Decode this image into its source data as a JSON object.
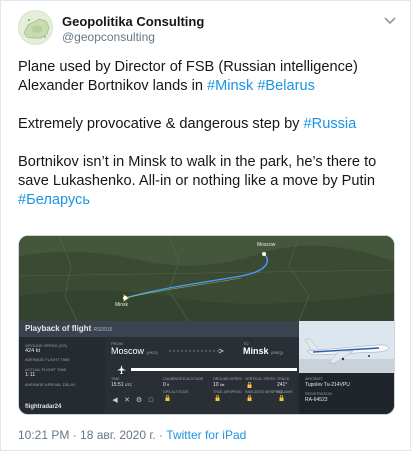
{
  "author": {
    "name": "Geopolitika Consulting",
    "handle": "@geopconsulting"
  },
  "tweet": {
    "line1": "Plane used by Director of FSB (Russian intelligence) Alexander Bortnikov lands in ",
    "tag_minsk": "#Minsk",
    "tag_belarus": "#Belarus",
    "line2": "Extremely provocative & dangerous step by ",
    "tag_russia": "#Russia",
    "line3": "Bortnikov isn’t in Minsk to walk in the park, he’s there to save Lukashenko. All-in or nothing like a move by Putin ",
    "tag_belarus_ru": "#Беларусь"
  },
  "media": {
    "panel_title": "Playback of flight",
    "flight_code": "RSD916",
    "ground_speed_label": "GROUND SPEED (GS)",
    "ground_speed": "424 kt",
    "flight_time_label": "AVERAGE FLIGHT TIME",
    "flight_time": "1:11",
    "actual_time_label": "ACTUAL FLIGHT TIME",
    "arrival_label": "AVERAGE ARRIVAL DELAY",
    "from_label": "FROM",
    "from_city": "Moscow",
    "from_code": "(VKO)",
    "to_label": "TO",
    "to_city": "Minsk",
    "to_code": "(MSQ)",
    "time_label": "TIME",
    "time_value": "15:51",
    "time_unit": "UTC",
    "cal_alt_label": "CALIBRATED ALTITUDE",
    "cal_alt_value": "0",
    "cal_alt_unit": "ft",
    "gps_alt_label": "GPS ALTITUDE",
    "ground_speed2_label": "GROUND SPEED",
    "ground_speed2_value": "10",
    "ground_speed2_unit": "kts",
    "true_speed_label": "TRUE AIRSPEED",
    "vertical_speed_label": "VERTICAL SPEED",
    "indicated_label": "INDICATED AIRSPEED",
    "track_label": "TRACK",
    "track_value": "241°",
    "squawk_label": "SQUAWK",
    "aircraft_label": "AIRCRAFT",
    "aircraft_value": "Tupolev Tu-214VPU",
    "registration_label": "REGISTRATION",
    "registration_value": "RA-64523",
    "logo": "flightradar24",
    "map_label_moscow": "Moscow",
    "map_label_minsk": "Minsk",
    "progress": 1.0
  },
  "meta": {
    "timestamp": "10:21 PM · 18 авг. 2020 г. · ",
    "source": "Twitter for iPad"
  }
}
